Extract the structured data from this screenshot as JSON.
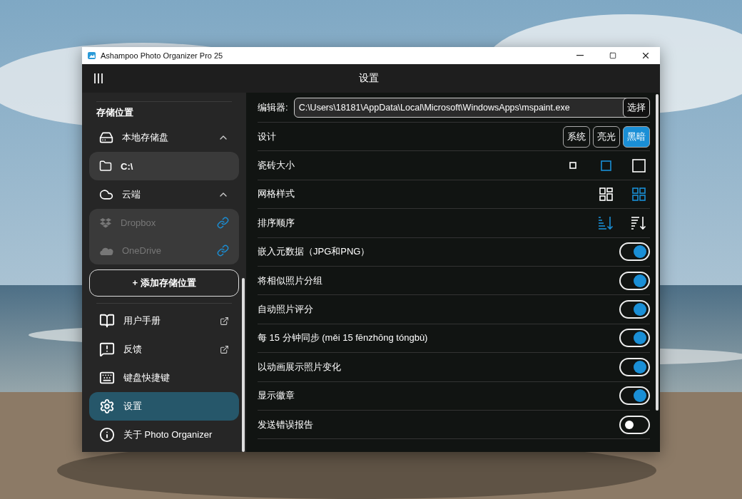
{
  "window": {
    "title": "Ashampoo Photo Organizer Pro 25"
  },
  "header": {
    "title": "设置"
  },
  "sidebar": {
    "section_title": "存储位置",
    "groups": [
      {
        "label": "本地存储盘",
        "kind": "drive",
        "expanded": true,
        "children": [
          {
            "label": "C:\\",
            "kind": "folder",
            "selected": true,
            "disabled": false
          }
        ]
      },
      {
        "label": "云端",
        "kind": "cloud",
        "expanded": true,
        "children": [
          {
            "label": "Dropbox",
            "kind": "dropbox",
            "selected": false,
            "disabled": true
          },
          {
            "label": "OneDrive",
            "kind": "onedrive",
            "selected": false,
            "disabled": true
          }
        ]
      }
    ],
    "add_button": "+ 添加存储位置",
    "menu": [
      {
        "label": "用户手册",
        "kind": "book",
        "external": true,
        "selected": false
      },
      {
        "label": "反馈",
        "kind": "feedback",
        "external": true,
        "selected": false
      },
      {
        "label": "键盘快捷键",
        "kind": "keyboard",
        "external": false,
        "selected": false
      },
      {
        "label": "设置",
        "kind": "gear",
        "external": false,
        "selected": true
      },
      {
        "label": "关于 Photo Organizer",
        "kind": "info",
        "external": false,
        "selected": false
      }
    ]
  },
  "settings": {
    "editor": {
      "label": "编辑器:",
      "value": "C:\\Users\\18181\\AppData\\Local\\Microsoft\\WindowsApps\\mspaint.exe",
      "button": "选择"
    },
    "rows": [
      {
        "kind": "segmented",
        "label": "设计",
        "options": [
          {
            "label": "系统",
            "selected": false
          },
          {
            "label": "亮光",
            "selected": false
          },
          {
            "label": "黑暗",
            "selected": true
          }
        ]
      },
      {
        "kind": "tile_size",
        "label": "瓷砖大小",
        "options": [
          {
            "selected": false
          },
          {
            "selected": true
          },
          {
            "selected": false
          }
        ]
      },
      {
        "kind": "grid_style",
        "label": "网格样式",
        "options": [
          {
            "selected": false
          },
          {
            "selected": true
          }
        ]
      },
      {
        "kind": "sort_order",
        "label": "排序顺序",
        "options": [
          {
            "selected": true
          },
          {
            "selected": false
          }
        ]
      },
      {
        "kind": "toggle",
        "label": "嵌入元数据（JPG和PNG）",
        "on": true
      },
      {
        "kind": "toggle",
        "label": "将相似照片分组",
        "on": true
      },
      {
        "kind": "toggle",
        "label": "自动照片评分",
        "on": true
      },
      {
        "kind": "toggle",
        "label": "每 15 分钟同步 (měi 15 fēnzhōng tóngbù)",
        "on": true
      },
      {
        "kind": "toggle",
        "label": "以动画展示照片变化",
        "on": true
      },
      {
        "kind": "toggle",
        "label": "显示徽章",
        "on": true
      },
      {
        "kind": "toggle",
        "label": "发送错误报告",
        "on": false
      }
    ]
  }
}
